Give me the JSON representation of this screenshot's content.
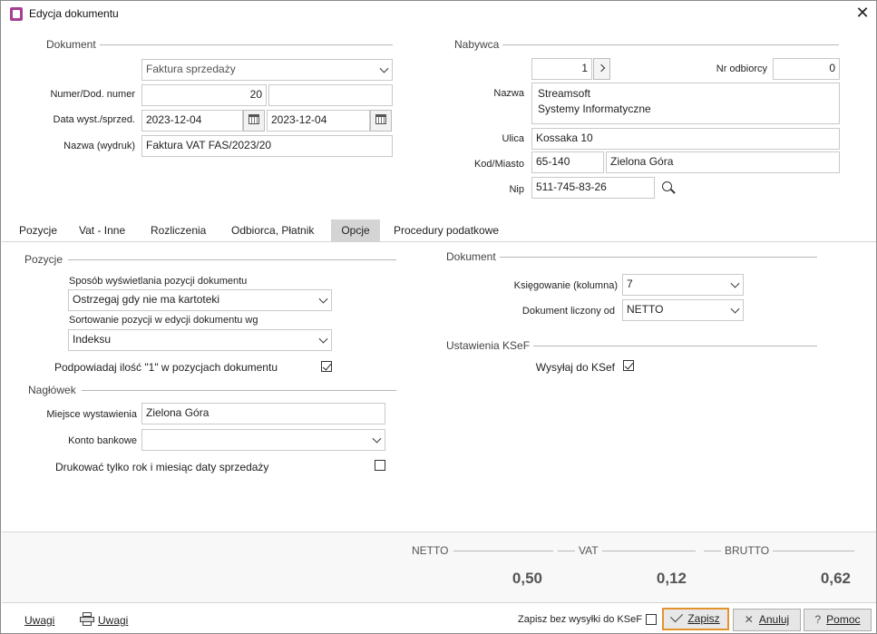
{
  "window": {
    "title": "Edycja dokumentu"
  },
  "dokument": {
    "section_title": "Dokument",
    "doc_type": "Faktura sprzedaży",
    "numer_label": "Numer/Dod. numer",
    "numer": "20",
    "dod_numer": "",
    "data_label": "Data wyst./sprzed.",
    "data_wyst": "2023-12-04",
    "data_sprzed": "2023-12-04",
    "nazwa_label": "Nazwa (wydruk)",
    "nazwa": "Faktura VAT FAS/2023/20"
  },
  "nabywca": {
    "section_title": "Nabywca",
    "kontrahent_num": "1",
    "nr_odbiorcy_label": "Nr odbiorcy",
    "nr_odbiorcy": "0",
    "nazwa_label": "Nazwa",
    "nazwa_line1": "Streamsoft",
    "nazwa_line2": "Systemy Informatyczne",
    "ulica_label": "Ulica",
    "ulica": "Kossaka 10",
    "kod_label": "Kod/Miasto",
    "kod": "65-140",
    "miasto": "Zielona Góra",
    "nip_label": "Nip",
    "nip": "511-745-83-26"
  },
  "tabs": [
    {
      "label": "Pozycje"
    },
    {
      "label": "Vat - Inne"
    },
    {
      "label": "Rozliczenia"
    },
    {
      "label": "Odbiorca, Płatnik"
    },
    {
      "label": "Opcje"
    },
    {
      "label": "Procedury podatkowe"
    }
  ],
  "opcje": {
    "pozycje_title": "Pozycje",
    "sposob_label": "Sposób wyświetlania pozycji dokumentu",
    "sposob_value": "Ostrzegaj gdy nie ma kartoteki",
    "sortowanie_label": "Sortowanie pozycji w edycji dokumentu wg",
    "sortowanie_value": "Indeksu",
    "podpowiadaj_label": "Podpowiadaj ilość \"1\" w pozycjach dokumentu",
    "naglowek_title": "Nagłówek",
    "miejsce_label": "Miejsce wystawienia",
    "miejsce_value": "Zielona Góra",
    "konto_label": "Konto bankowe",
    "konto_value": "",
    "drukowac_label": "Drukować tylko rok i miesiąc daty sprzedaży",
    "dokument_title": "Dokument",
    "ksiegowanie_label": "Księgowanie (kolumna)",
    "ksiegowanie_value": "7",
    "liczony_label": "Dokument liczony od",
    "liczony_value": "NETTO",
    "ksef_title": "Ustawienia KSeF",
    "wysylaj_label": "Wysyłaj do KSef"
  },
  "summary": {
    "netto_label": "NETTO",
    "netto": "0,50",
    "vat_label": "VAT",
    "vat": "0,12",
    "brutto_label": "BRUTTO",
    "brutto": "0,62"
  },
  "bottom": {
    "uwagi1": "Uwagi",
    "uwagi2": "Uwagi",
    "zapisz_bez_label": "Zapisz bez wysyłki do KSeF",
    "zapisz": "Zapisz",
    "anuluj": "Anuluj",
    "pomoc": "Pomoc"
  }
}
